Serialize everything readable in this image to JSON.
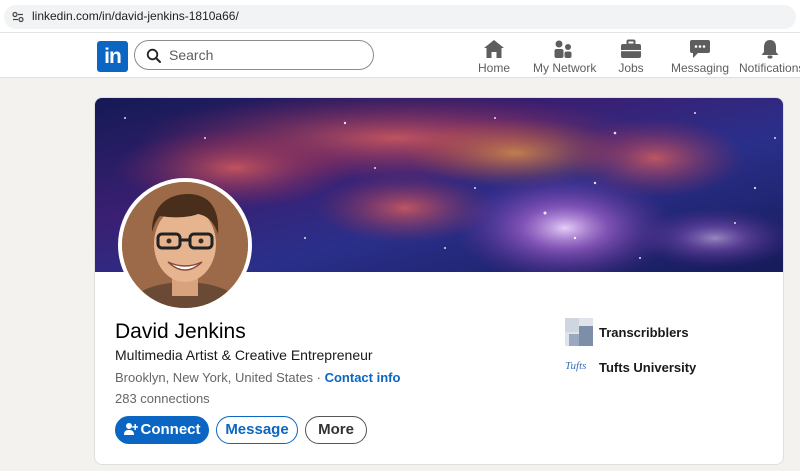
{
  "browser": {
    "url": "linkedin.com/in/david-jenkins-1810a66/"
  },
  "nav": {
    "logo_text": "in",
    "search_placeholder": "Search",
    "items": [
      {
        "label": "Home",
        "icon": "home-icon"
      },
      {
        "label": "My Network",
        "icon": "network-icon"
      },
      {
        "label": "Jobs",
        "icon": "briefcase-icon"
      },
      {
        "label": "Messaging",
        "icon": "chat-icon"
      },
      {
        "label": "Notifications",
        "icon": "bell-icon"
      }
    ]
  },
  "profile": {
    "name": "David Jenkins",
    "headline": "Multimedia Artist & Creative Entrepreneur",
    "location": "Brooklyn, New York, United States",
    "separator": "·",
    "contact_info": "Contact info",
    "connections": "283 connections",
    "buttons": {
      "connect": "Connect",
      "message": "Message",
      "more": "More"
    },
    "orgs": [
      {
        "name": "Transcribblers"
      },
      {
        "name": "Tufts University",
        "logo_text": "Tufts"
      }
    ]
  },
  "colors": {
    "brand": "#0a66c2",
    "page_bg": "#f4f2ee"
  }
}
